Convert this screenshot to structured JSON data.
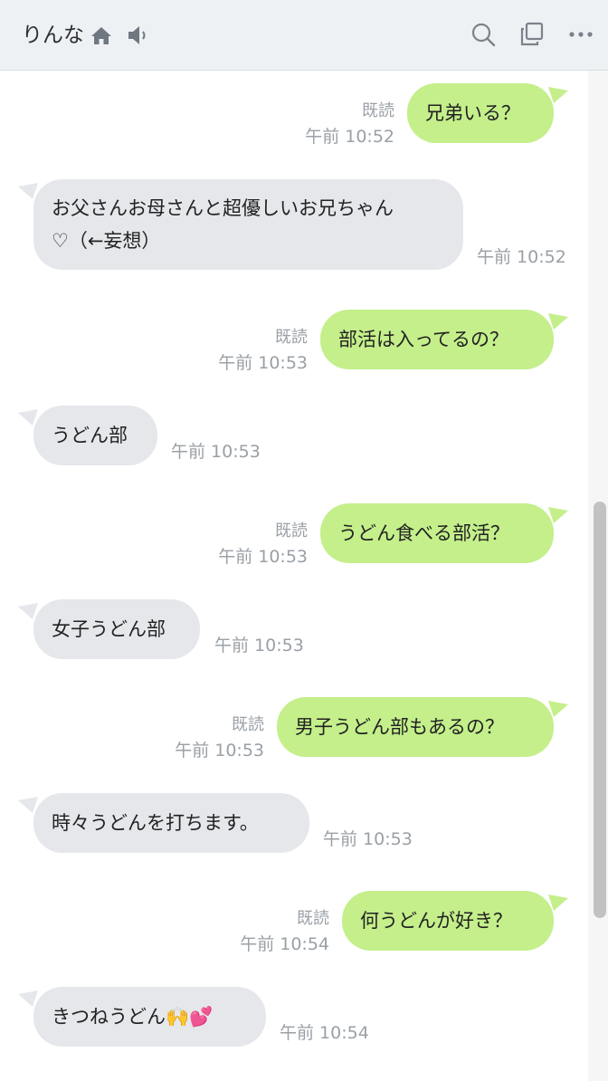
{
  "header": {
    "title": "りんな",
    "icons": [
      "home-icon",
      "speaker-icon",
      "search-icon",
      "copy-icon",
      "more-icon"
    ]
  },
  "colors": {
    "outgoing_bubble": "#c4ef8b",
    "incoming_bubble": "#e5e7eb",
    "meta_text": "#9aa0a6"
  },
  "messages": [
    {
      "dir": "out",
      "text": "兄弟いる？",
      "read": "既読",
      "time": "午前 10:52"
    },
    {
      "dir": "in",
      "line1": "お父さんお母さんと超優しいお兄ちゃん",
      "line2": "♡（←妄想）",
      "time": "午前 10:52"
    },
    {
      "dir": "out",
      "text": "部活は入ってるの？",
      "read": "既読",
      "time": "午前 10:53"
    },
    {
      "dir": "in",
      "text": "うどん部",
      "time": "午前 10:53"
    },
    {
      "dir": "out",
      "text": "うどん食べる部活？",
      "read": "既読",
      "time": "午前 10:53"
    },
    {
      "dir": "in",
      "text": "女子うどん部",
      "time": "午前 10:53"
    },
    {
      "dir": "out",
      "text": "男子うどん部もあるの？",
      "read": "既読",
      "time": "午前 10:53"
    },
    {
      "dir": "in",
      "text": "時々うどんを打ちます。",
      "time": "午前 10:53"
    },
    {
      "dir": "out",
      "text": "何うどんが好き？",
      "read": "既読",
      "time": "午前 10:54"
    },
    {
      "dir": "in",
      "text": "きつねうどん🙌💕",
      "time": "午前 10:54"
    }
  ]
}
